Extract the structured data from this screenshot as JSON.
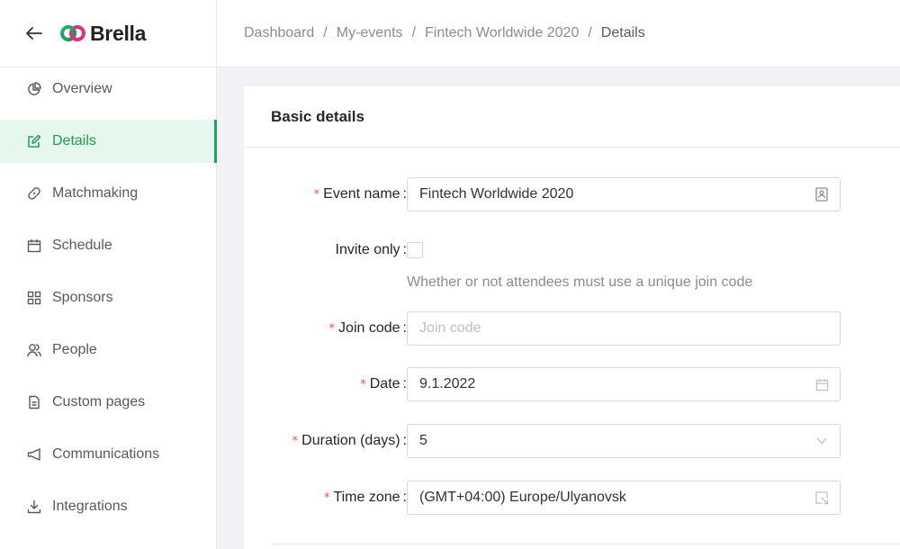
{
  "brand": {
    "name": "Brella",
    "accent": "#1fa463"
  },
  "sidebar": {
    "items": [
      {
        "label": "Overview",
        "icon": "pie-chart-icon"
      },
      {
        "label": "Details",
        "icon": "edit-icon",
        "active": true
      },
      {
        "label": "Matchmaking",
        "icon": "link-icon"
      },
      {
        "label": "Schedule",
        "icon": "calendar-icon"
      },
      {
        "label": "Sponsors",
        "icon": "grid-icon"
      },
      {
        "label": "People",
        "icon": "people-icon"
      },
      {
        "label": "Custom pages",
        "icon": "document-icon"
      },
      {
        "label": "Communications",
        "icon": "megaphone-icon"
      },
      {
        "label": "Integrations",
        "icon": "download-icon"
      }
    ]
  },
  "breadcrumb": {
    "items": [
      "Dashboard",
      "My-events",
      "Fintech Worldwide 2020",
      "Details"
    ],
    "separator": "/"
  },
  "card": {
    "title": "Basic details",
    "fields": {
      "event_name": {
        "label": "Event name",
        "value": "Fintech Worldwide 2020",
        "required": true
      },
      "invite_only": {
        "label": "Invite only",
        "checked": false,
        "help": "Whether or not attendees must use a unique join code"
      },
      "join_code": {
        "label": "Join code",
        "placeholder": "Join code",
        "required": true
      },
      "date": {
        "label": "Date",
        "value": "9.1.2022",
        "required": true
      },
      "duration": {
        "label": "Duration (days)",
        "value": "5",
        "required": true
      },
      "time_zone": {
        "label": "Time zone",
        "value": "(GMT+04:00) Europe/Ulyanovsk",
        "required": true
      }
    },
    "colon": ":",
    "required_mark": "*"
  }
}
